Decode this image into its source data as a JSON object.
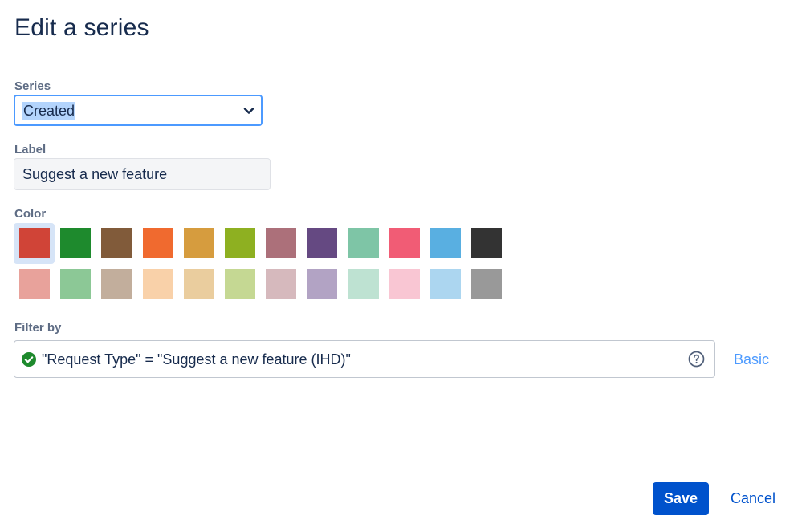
{
  "dialog": {
    "title": "Edit a series"
  },
  "series": {
    "label": "Series",
    "selected": "Created"
  },
  "label_field": {
    "label": "Label",
    "value": "Suggest a new feature"
  },
  "color": {
    "label": "Color",
    "selected_index": 0,
    "row1": [
      "#d04437",
      "#1e8a2d",
      "#815b3a",
      "#f06a2f",
      "#d69c3e",
      "#8eb021",
      "#ac707a",
      "#654982",
      "#7ec5a6",
      "#f15c75",
      "#59afe1",
      "#333333"
    ],
    "row2": [
      "#e8a29b",
      "#8cc896",
      "#c2ae9c",
      "#f9d1a9",
      "#eacd9e",
      "#c5d893",
      "#d6b9bd",
      "#b2a3c4",
      "#bee2d2",
      "#f9c6d3",
      "#acd6f0",
      "#999999"
    ]
  },
  "filter": {
    "label": "Filter by",
    "query": "\"Request Type\" = \"Suggest a new feature (IHD)\"",
    "status_icon": "check-circle-icon",
    "help_icon": "question-circle-icon",
    "mode_link": "Basic"
  },
  "actions": {
    "save": "Save",
    "cancel": "Cancel"
  }
}
